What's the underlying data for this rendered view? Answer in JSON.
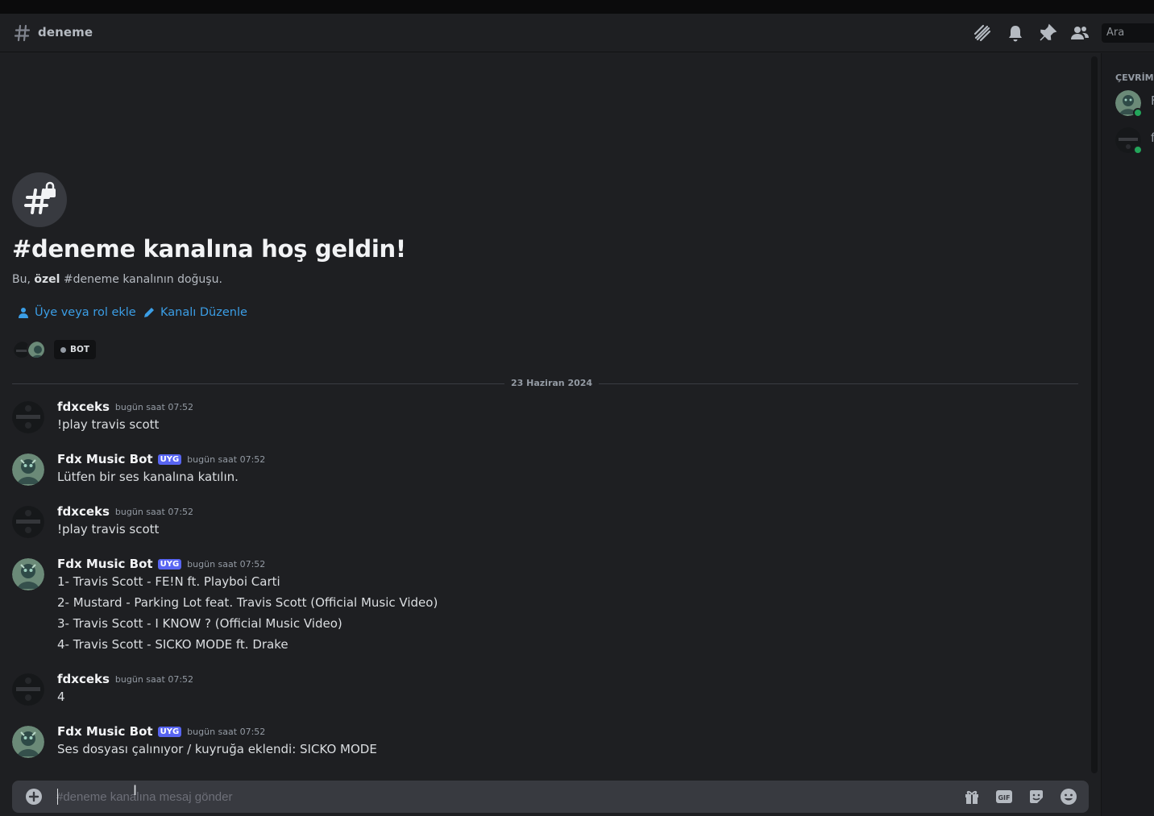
{
  "header": {
    "channel_name": "deneme",
    "search_placeholder": "Ara",
    "icons": [
      "threads-icon",
      "bell-icon",
      "pin-icon",
      "members-icon"
    ]
  },
  "welcome": {
    "title": "#deneme kanalına hoş geldin!",
    "subtitle_prefix": "Bu,",
    "subtitle_bold": "özel",
    "subtitle_suffix": "#deneme kanalının doğuşu.",
    "add_member_label": "Üye veya rol ekle",
    "edit_channel_label": "Kanalı Düzenle",
    "bot_pill": "BOT"
  },
  "date_divider": "23 Haziran 2024",
  "messages": [
    {
      "author": "fdxceks",
      "tag": "",
      "time": "bugün saat 07:52",
      "lines": [
        "!play travis scott"
      ]
    },
    {
      "author": "Fdx Music Bot",
      "tag": "UYG",
      "time": "bugün saat 07:52",
      "lines": [
        "Lütfen bir ses kanalına katılın."
      ]
    },
    {
      "author": "fdxceks",
      "tag": "",
      "time": "bugün saat 07:52",
      "lines": [
        "!play travis scott"
      ]
    },
    {
      "author": "Fdx Music Bot",
      "tag": "UYG",
      "time": "bugün saat 07:52",
      "lines": [
        "1- Travis Scott - FE!N ft. Playboi Carti",
        "2- Mustard - Parking Lot feat. Travis Scott (Official Music Video)",
        "3- Travis Scott - I KNOW ? (Official Music Video)",
        "4- Travis Scott - SICKO MODE ft. Drake"
      ]
    },
    {
      "author": "fdxceks",
      "tag": "",
      "time": "bugün saat 07:52",
      "lines": [
        "4"
      ]
    },
    {
      "author": "Fdx Music Bot",
      "tag": "UYG",
      "time": "bugün saat 07:52",
      "lines": [
        "Ses dosyası çalınıyor / kuyruğa eklendi: SICKO MODE"
      ]
    }
  ],
  "composer": {
    "placeholder": "#deneme kanalına mesaj gönder",
    "icons": [
      "gift-icon",
      "gif-icon",
      "sticker-icon",
      "emoji-icon"
    ]
  },
  "members_panel": {
    "category": "ÇEVRİM İ",
    "items": [
      {
        "name": "F",
        "status": "online"
      },
      {
        "name": "f",
        "status": "online"
      }
    ]
  },
  "colors": {
    "background": "#1e1f22",
    "link": "#3b9ee6",
    "app_tag": "#5865f2",
    "online": "#23a55a"
  }
}
